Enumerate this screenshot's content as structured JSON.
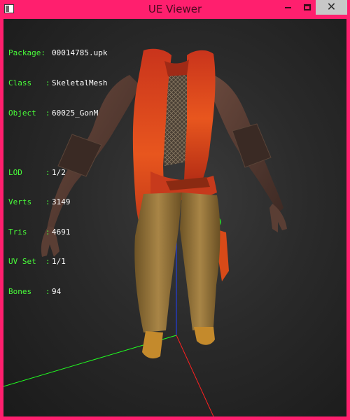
{
  "window": {
    "title": "UE Viewer",
    "close_glyph": "✕"
  },
  "info": {
    "package_label": "Package:",
    "package": "00014785.upk",
    "class_label": "Class",
    "class": "SkeletalMesh",
    "object_label": "Object",
    "object": "60025_GonM",
    "lod_label": "LOD",
    "lod": "1/2",
    "verts_label": "Verts",
    "verts": "3149",
    "tris_label": "Tris",
    "tris": "4691",
    "uvset_label": "UV Set",
    "uvset": "1/1",
    "bones_label": "Bones",
    "bones": "94",
    "separator": ":"
  },
  "colors": {
    "frame": "#ff1f6e",
    "label_text": "#49ff3a",
    "value_text": "#ffffff",
    "axis_x": "#ff2020",
    "axis_y": "#20ff20",
    "axis_z": "#2040ff"
  },
  "icons": {
    "app": "app-window-icon",
    "minimize": "minimize-icon",
    "maximize": "maximize-icon",
    "close": "close-icon"
  }
}
